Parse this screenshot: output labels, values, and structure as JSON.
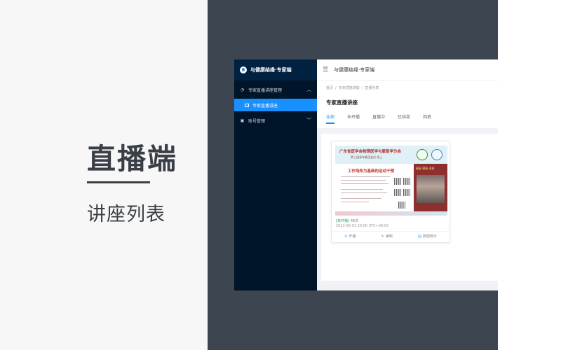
{
  "caption": {
    "title": "直播端",
    "subtitle": "讲座列表"
  },
  "app": {
    "brand": "与健康结缘·专家端",
    "sidebar": {
      "groups": [
        {
          "label": "专家直播讲座管理",
          "icon": "live-icon",
          "expanded": true,
          "items": [
            {
              "label": "专家直播讲座",
              "icon": "monitor-icon",
              "active": true
            }
          ]
        },
        {
          "label": "账号管理",
          "icon": "account-icon",
          "expanded": false
        }
      ]
    },
    "topbar": {
      "title": "与健康结缘·专家端",
      "menu_icon": "hamburger-icon"
    },
    "breadcrumb": [
      "首页",
      "专家直播讲座",
      "直播列表"
    ],
    "page_title": "专家直播讲座",
    "tabs": [
      "全部",
      "未开播",
      "直播中",
      "已结束",
      "回放"
    ],
    "active_tab": 0,
    "cards": [
      {
        "poster": {
          "heading": "广东省医学会物理医学与康复学分会",
          "subheading": "第三届青年委员会议 线上",
          "topic": "工作场所为基础的运动干预",
          "side_caption": "康复 健康 讲座"
        },
        "status": "[未开播]",
        "count": "45次",
        "time": "2022-08-03 20:00 UTC+08:00",
        "actions": [
          {
            "label": "开播",
            "icon": "play-icon"
          },
          {
            "label": "编辑",
            "icon": "edit-icon"
          },
          {
            "label": "数据统计",
            "icon": "stats-icon"
          }
        ]
      }
    ]
  },
  "colors": {
    "accent": "#1890ff",
    "sidebar_bg": "#001529",
    "backdrop": "#3d4650",
    "status_green": "#19a15f"
  }
}
